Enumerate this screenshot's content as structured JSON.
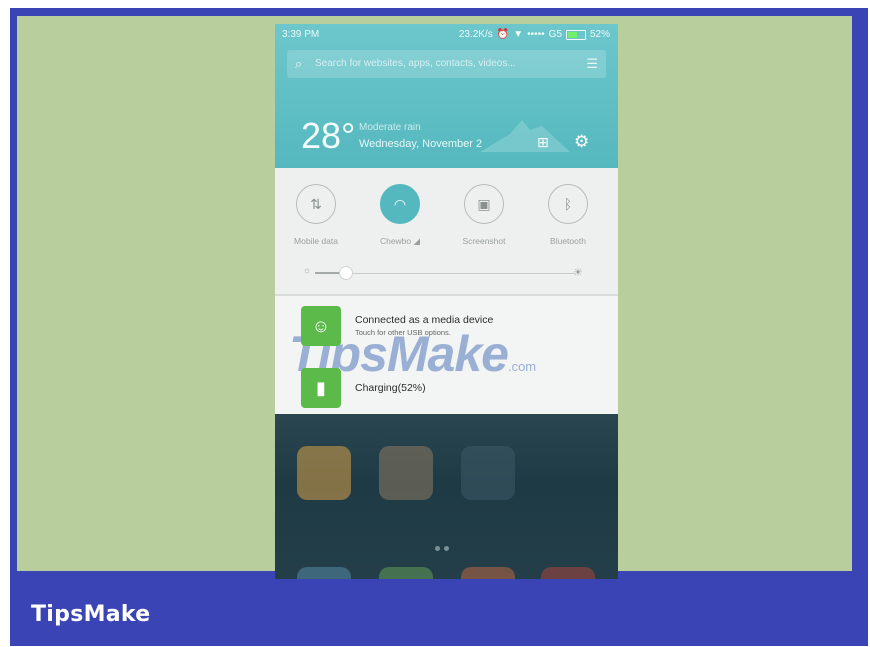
{
  "status_bar": {
    "time": "3:39 PM",
    "speed": "23.2K/s",
    "network": "G5",
    "signal": "•••••",
    "battery": "52%"
  },
  "search": {
    "placeholder": "Search for websites, apps, contacts, videos..."
  },
  "weather": {
    "temperature": "28°",
    "condition": "Moderate rain",
    "date": "Wednesday, November 2"
  },
  "toggles": [
    {
      "label": "Mobile data",
      "icon": "mobile-data-icon",
      "on": false
    },
    {
      "label": "Chewbo ◢",
      "icon": "wifi-icon",
      "on": true
    },
    {
      "label": "Screenshot",
      "icon": "screenshot-icon",
      "on": false
    },
    {
      "label": "Bluetooth",
      "icon": "bluetooth-icon",
      "on": false
    }
  ],
  "brightness": {
    "level_fraction": 0.12
  },
  "notifications": [
    {
      "title": "Connected as a media device",
      "subtitle": "Touch for other USB options.",
      "icon": "usb-android-icon"
    },
    {
      "title": "Charging(52%)",
      "subtitle": "",
      "icon": "battery-icon"
    }
  ],
  "watermark": {
    "text": "TipsMake",
    "suffix": ".com"
  },
  "brand": {
    "text": "TipsMake"
  },
  "colors": {
    "frame": "#3a44b4",
    "background": "#b8cf9d",
    "accent_teal": "#55b8bf",
    "notification_icon": "#5cba4a"
  }
}
